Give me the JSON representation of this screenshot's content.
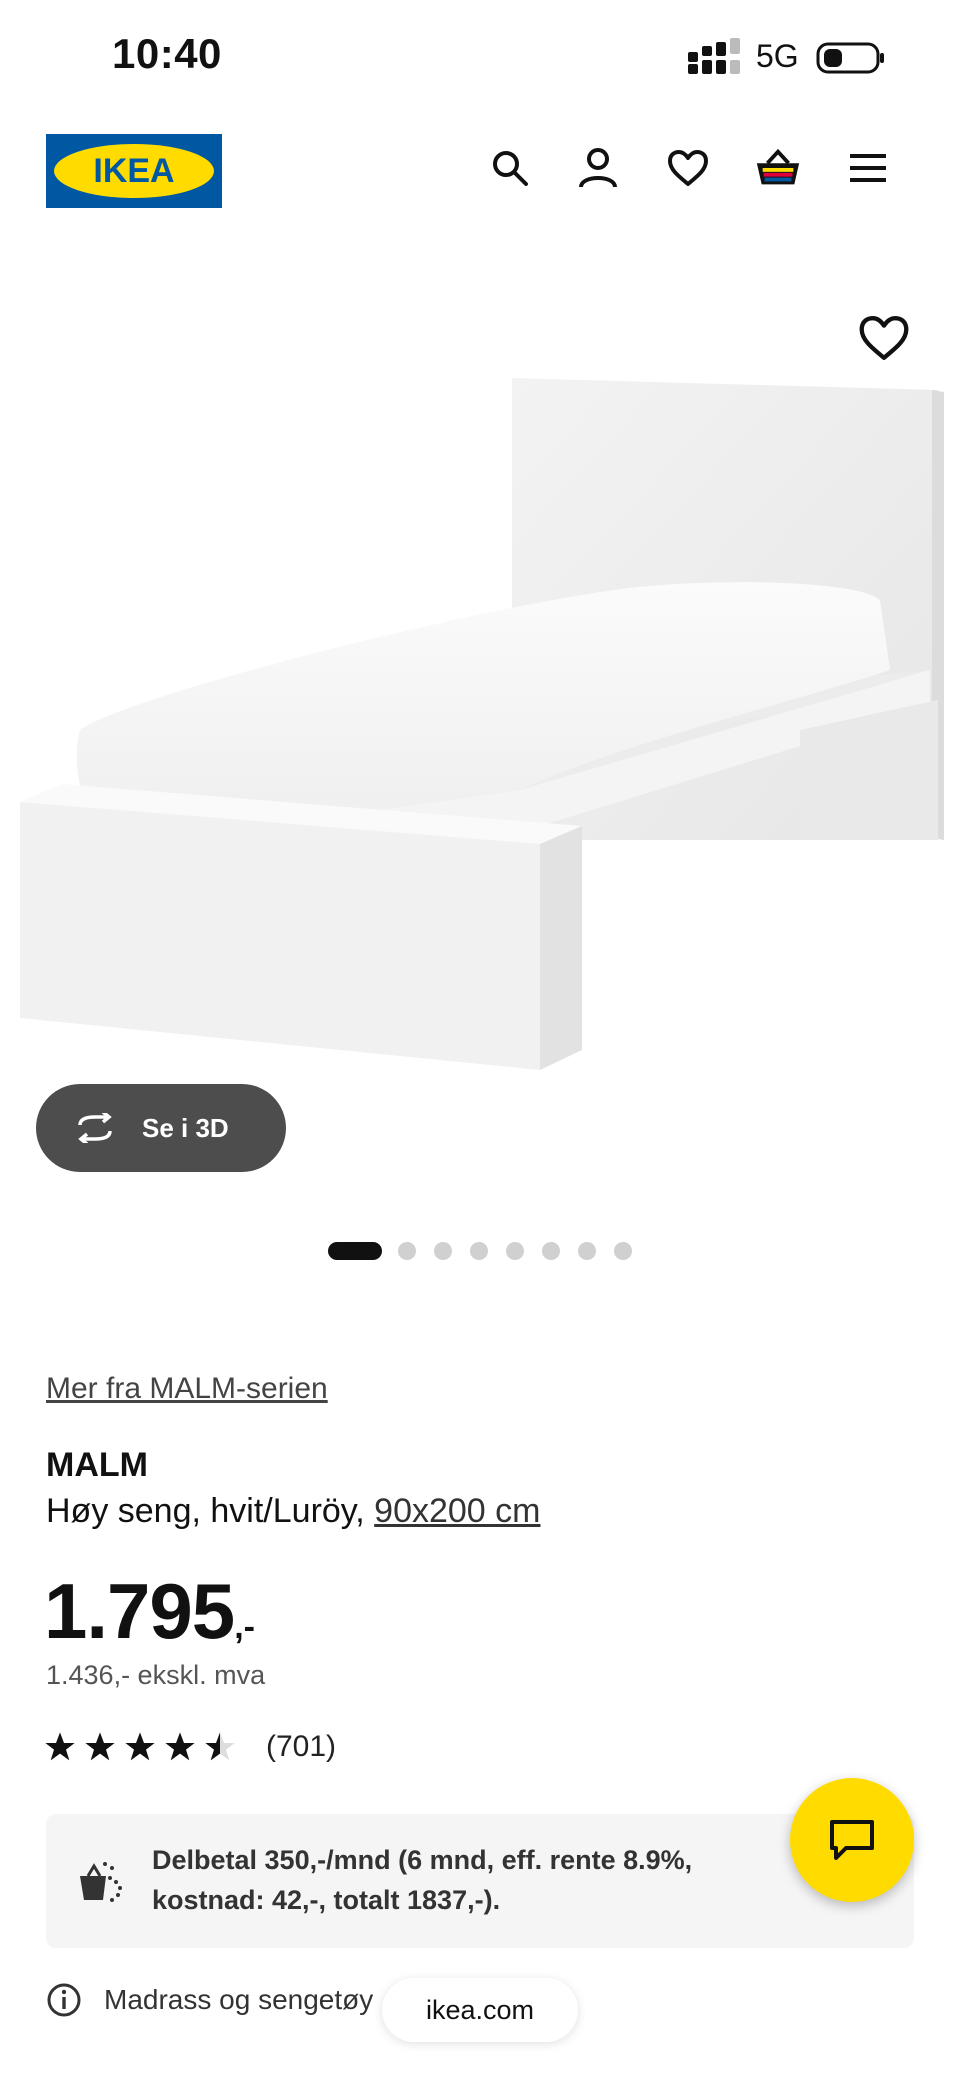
{
  "status_bar": {
    "time": "10:40",
    "network": "5G"
  },
  "header": {
    "logo_text": "IKEA",
    "icons": [
      "search-icon",
      "account-icon",
      "wishlist-icon",
      "cart-icon",
      "menu-icon"
    ]
  },
  "media": {
    "see_3d_label": "Se i 3D",
    "dot_count": 8,
    "active_dot": 0
  },
  "product": {
    "series_link": "Mer fra MALM-serien",
    "name": "MALM",
    "description": "Høy seng, hvit/Luröy,",
    "size": "90x200 cm",
    "price_main": "1.795",
    "price_suffix": ",-",
    "price_ex_vat": "1.436,- ekskl. mva",
    "rating": 4.5,
    "review_count": "(701)"
  },
  "installment": {
    "text": "Delbetal 350,-/mnd (6 mnd, eff. rente 8.9%, kostnad: 42,-, totalt 1837,-)."
  },
  "info": {
    "text": "Madrass og sengetøy"
  },
  "browser": {
    "url": "ikea.com"
  },
  "colors": {
    "brand_blue": "#0058a3",
    "brand_yellow": "#ffdb00",
    "dark_pill": "#4d4d4d"
  }
}
